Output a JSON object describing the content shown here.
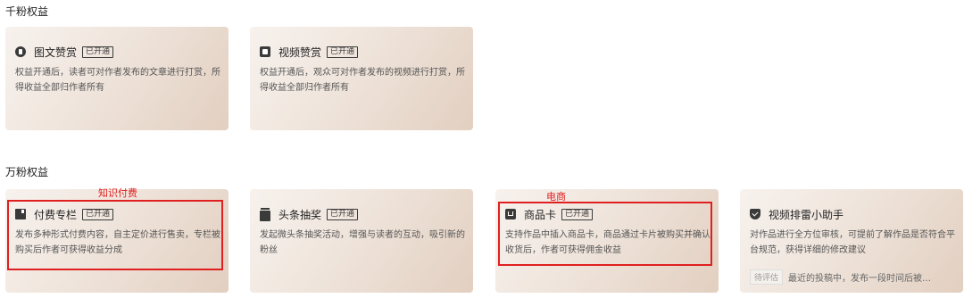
{
  "sections": [
    {
      "title": "千粉权益"
    },
    {
      "title": "万粉权益"
    }
  ],
  "cards": [
    {
      "title": "图文赞赏",
      "badge": "已开通",
      "icon": "thumb-up-icon",
      "desc": "权益开通后，读者可对作者发布的文章进行打赏，所得收益全部归作者所有"
    },
    {
      "title": "视频赞赏",
      "badge": "已开通",
      "icon": "video-icon",
      "desc": "权益开通后，观众可对作者发布的视频进行打赏，所得收益全部归作者所有"
    },
    {
      "title": "付费专栏",
      "badge": "已开通",
      "icon": "column-icon",
      "desc": "发布多种形式付费内容，自主定价进行售卖，专栏被购买后作者可获得收益分成"
    },
    {
      "title": "头条抽奖",
      "badge": "已开通",
      "icon": "lottery-icon",
      "desc": "发起微头条抽奖活动，增强与读者的互动，吸引新的粉丝"
    },
    {
      "title": "商品卡",
      "badge": "已开通",
      "icon": "product-card-icon",
      "desc": "支持作品中插入商品卡，商品通过卡片被购买并确认收货后，作者可获得佣金收益"
    },
    {
      "title": "视频排雷小助手",
      "icon": "shield-check-icon",
      "desc": "对作品进行全方位审核，可提前了解作品是否符合平台规范，获得详细的修改建议",
      "tag": "待评估",
      "tag_text": "最近的投稿中，发布一段时间后被…"
    }
  ],
  "annotations": [
    {
      "label": "知识付费"
    },
    {
      "label": "电商"
    }
  ],
  "colors": {
    "annotation": "#e02020",
    "card_gradient_start": "#f7f2ee",
    "card_gradient_end": "#e2cfc0"
  }
}
